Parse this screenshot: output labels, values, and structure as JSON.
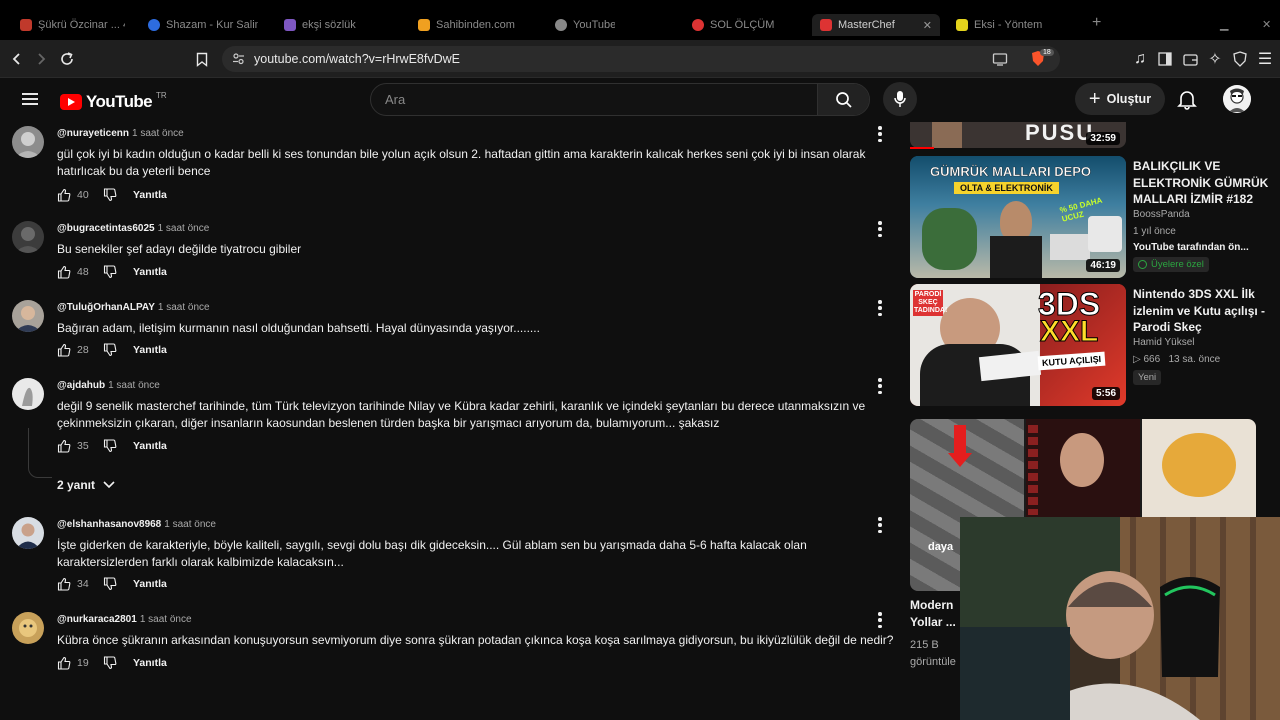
{
  "browser": {
    "tabs": [
      {
        "label": "Şükrü Özcinar ... 4 saat",
        "color": "#c0392b"
      },
      {
        "label": "Shazam - Kur Salim",
        "color": "#2d6cdf"
      },
      {
        "label": "ekşi sözlük",
        "color": "#7e57c2"
      },
      {
        "label": "Sahibinden.com",
        "color": "#f0a020"
      },
      {
        "label": "YouTube",
        "color": "#888888"
      },
      {
        "label": "SOL ÖLÇÜM",
        "color": "#d33"
      },
      {
        "label": "MasterChef",
        "color": "#d33"
      },
      {
        "label": "Eksi - Yöntem",
        "color": "#e3d31c"
      }
    ],
    "url": "youtube.com/watch?v=rHrwE8fvDwE",
    "shield_badge": "18"
  },
  "header": {
    "logo_text": "YouTube",
    "country_code": "TR",
    "search_placeholder": "Ara",
    "create_label": "Oluştur"
  },
  "comments": [
    {
      "handle": "@nurayeticenn",
      "time": "1 saat önce",
      "text": "gül çok iyi bi kadın olduğun o kadar belli ki ses tonundan bile yolun açık olsun 2. haftadan gittin ama karakterin kalıcak herkes seni çok iyi bi insan olarak hatırlıcak bu da yeterli bence",
      "likes": "40",
      "reply_label": "Yanıtla"
    },
    {
      "handle": "@bugracetintas6025",
      "time": "1 saat önce",
      "text": "Bu senekiler şef adayı değilde tiyatrocu gibiler",
      "likes": "48",
      "reply_label": "Yanıtla"
    },
    {
      "handle": "@TuluğOrhanALPAY",
      "time": "1 saat önce",
      "text": "Bağıran adam, iletişim kurmanın nasıl olduğundan bahsetti. Hayal dünyasında yaşıyor........",
      "likes": "28",
      "reply_label": "Yanıtla"
    },
    {
      "handle": "@ajdahub",
      "time": "1 saat önce",
      "text": "değil 9 senelik masterchef tarihinde, tüm Türk televizyon tarihinde Nilay ve Kübra kadar zehirli, karanlık ve içindeki şeytanları bu derece utanmaksızın ve çekinmeksizin çıkaran, diğer insanların kaosundan beslenen türden başka bir yarışmacı arıyorum da, bulamıyorum... şakasız",
      "likes": "35",
      "reply_label": "Yanıtla",
      "replies_label": "2 yanıt"
    },
    {
      "handle": "@elshanhasanov8968",
      "time": "1 saat önce",
      "text": "İşte giderken de karakteriyle, böyle kaliteli, saygılı, sevgi dolu başı dik gideceksin.... Gül ablam sen bu yarışmada daha 5-6 hafta kalacak olan karaktersizlerden farklı olarak kalbimizde kalacaksın...",
      "likes": "34",
      "reply_label": "Yanıtla"
    },
    {
      "handle": "@nurkaraca2801",
      "time": "1 saat önce",
      "text": "Kübra önce şükranın arkasından konuşuyorsun sevmiyorum diye sonra şükran potadan çıkınca koşa koşa sarılmaya gidiyorsun, bu ikiyüzlülük değil de nedir?",
      "likes": "19",
      "reply_label": "Yanıtla"
    }
  ],
  "sidebar": {
    "top_duration": "32:59",
    "videos": [
      {
        "title": "BALIKÇILIK VE ELEKTRONİK GÜMRÜK MALLARI İZMİR #182",
        "channel": "BoossPanda",
        "meta": "1 yıl önce",
        "extra": "YouTube tarafından ön...",
        "badge": "Üyelere özel",
        "duration": "46:19",
        "thumb_text_1": "GÜMRÜK MALLARI DEPO",
        "thumb_text_2": "OLTA & ELEKTRONİK",
        "thumb_text_3": "% 50 DAHA UCUZ"
      },
      {
        "title": "Nintendo 3DS XXL İlk izlenim ve Kutu açılışı - Parodi Skeç",
        "channel": "Hamid Yüksel",
        "views": "666",
        "meta": "13 sa. önce",
        "badge": "Yeni",
        "duration": "5:56",
        "thumb_text_1": "3DS",
        "thumb_text_2": "XXL",
        "thumb_text_3": "KUTU AÇILIŞI",
        "thumb_text_4": "PARODİ SKEÇ TADINDA!"
      },
      {
        "title": "Modern Yollar ...",
        "meta": "215 B görüntüle",
        "thumb_text_1": "daya"
      }
    ]
  },
  "colors": {
    "background": "#0f0f0f",
    "text": "#f1f1f1",
    "muted": "#aaaaaa",
    "brand_red": "#ff0000",
    "member_green": "#2ba640"
  }
}
